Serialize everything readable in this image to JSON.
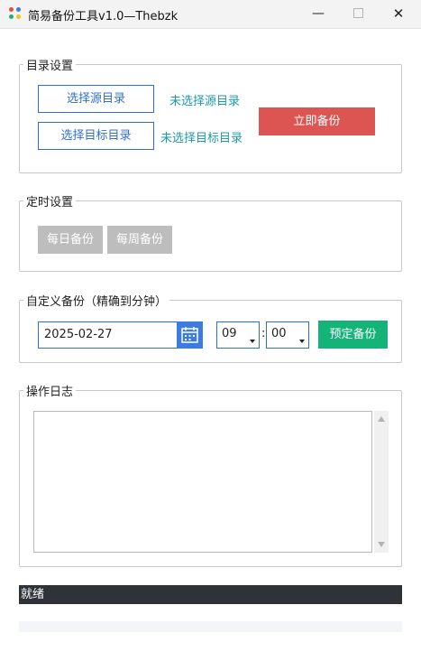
{
  "window": {
    "title": "简易备份工具v1.0—Thebzk",
    "minimize": "—",
    "close": "✕"
  },
  "directory": {
    "legend": "目录设置",
    "select_source": "选择源目录",
    "source_status": "未选择源目录",
    "select_target": "选择目标目录",
    "target_status": "未选择目标目录",
    "backup_now": "立即备份"
  },
  "schedule": {
    "legend": "定时设置",
    "daily": "每日备份",
    "weekly": "每周备份"
  },
  "custom": {
    "legend": "自定义备份（精确到分钟）",
    "date": "2025-02-27",
    "hour": "09",
    "colon": ":",
    "minute": "00",
    "schedule_button": "预定备份"
  },
  "log": {
    "legend": "操作日志",
    "content": ""
  },
  "status": {
    "text": "就绪",
    "progress": 0
  },
  "colors": {
    "accent_blue": "#2f6fd0",
    "backup_red": "#dd5552",
    "schedule_green": "#14b478",
    "status_teal": "#1f9aa8",
    "disabled_gray": "#bdbdbd"
  },
  "icons": {
    "app": "app-grid-icon",
    "calendar": "calendar-icon"
  }
}
